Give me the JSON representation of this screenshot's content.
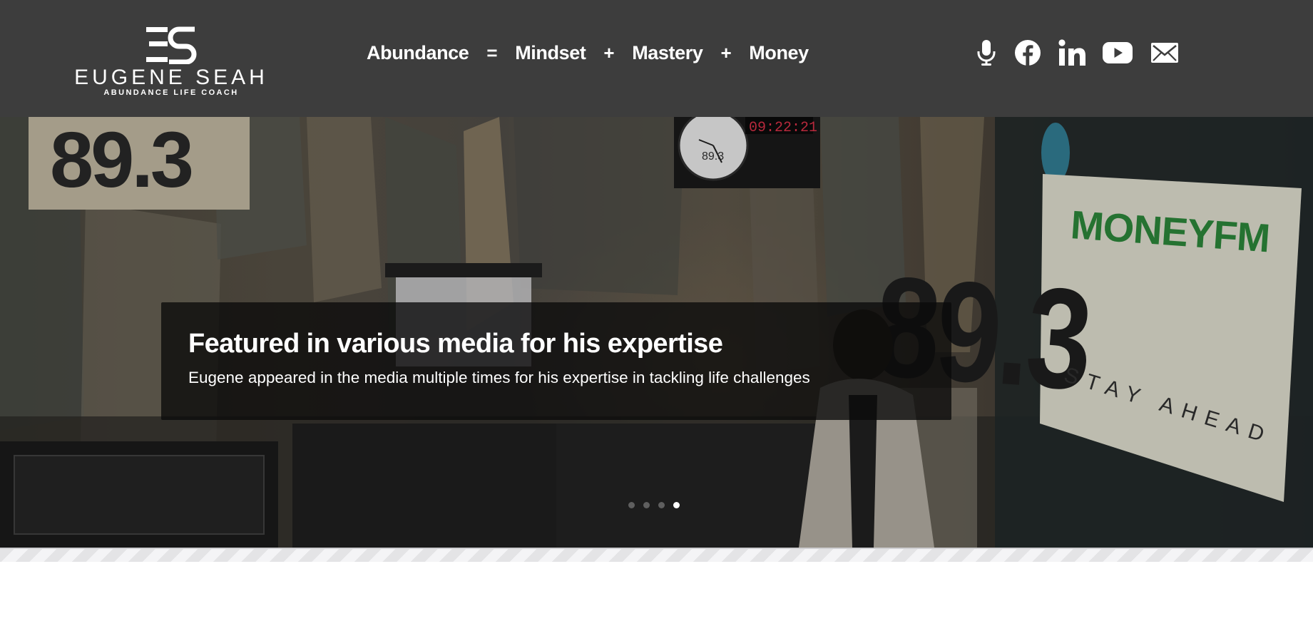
{
  "header": {
    "logo": {
      "name": "EUGENE SEAH",
      "tagline": "ABUNDANCE LIFE COACH"
    },
    "nav": [
      {
        "label": "Abundance"
      },
      {
        "operator": "="
      },
      {
        "label": "Mindset"
      },
      {
        "operator": "+"
      },
      {
        "label": "Mastery"
      },
      {
        "operator": "+"
      },
      {
        "label": "Money"
      }
    ],
    "social_icons": [
      "microphone-icon",
      "facebook-icon",
      "linkedin-icon",
      "youtube-icon",
      "email-icon"
    ]
  },
  "hero": {
    "background": {
      "station_number": "89.3",
      "clock_time": "09:22:21",
      "sign_brand": "MONEYFM",
      "sign_number": "89.3",
      "sign_slogan": "STAY AHEAD"
    },
    "caption": {
      "title": "Featured in various media for his expertise",
      "subtitle": "Eugene appeared in the media multiple times for his expertise in tackling life challenges"
    },
    "slider": {
      "slide_count": 4,
      "active_slide": 4
    }
  },
  "colors": {
    "header_bg": "#3d3d3d",
    "text_light": "#ffffff",
    "caption_bg": "rgba(10,10,10,0.78)",
    "sign_green": "#2e8b3c"
  }
}
